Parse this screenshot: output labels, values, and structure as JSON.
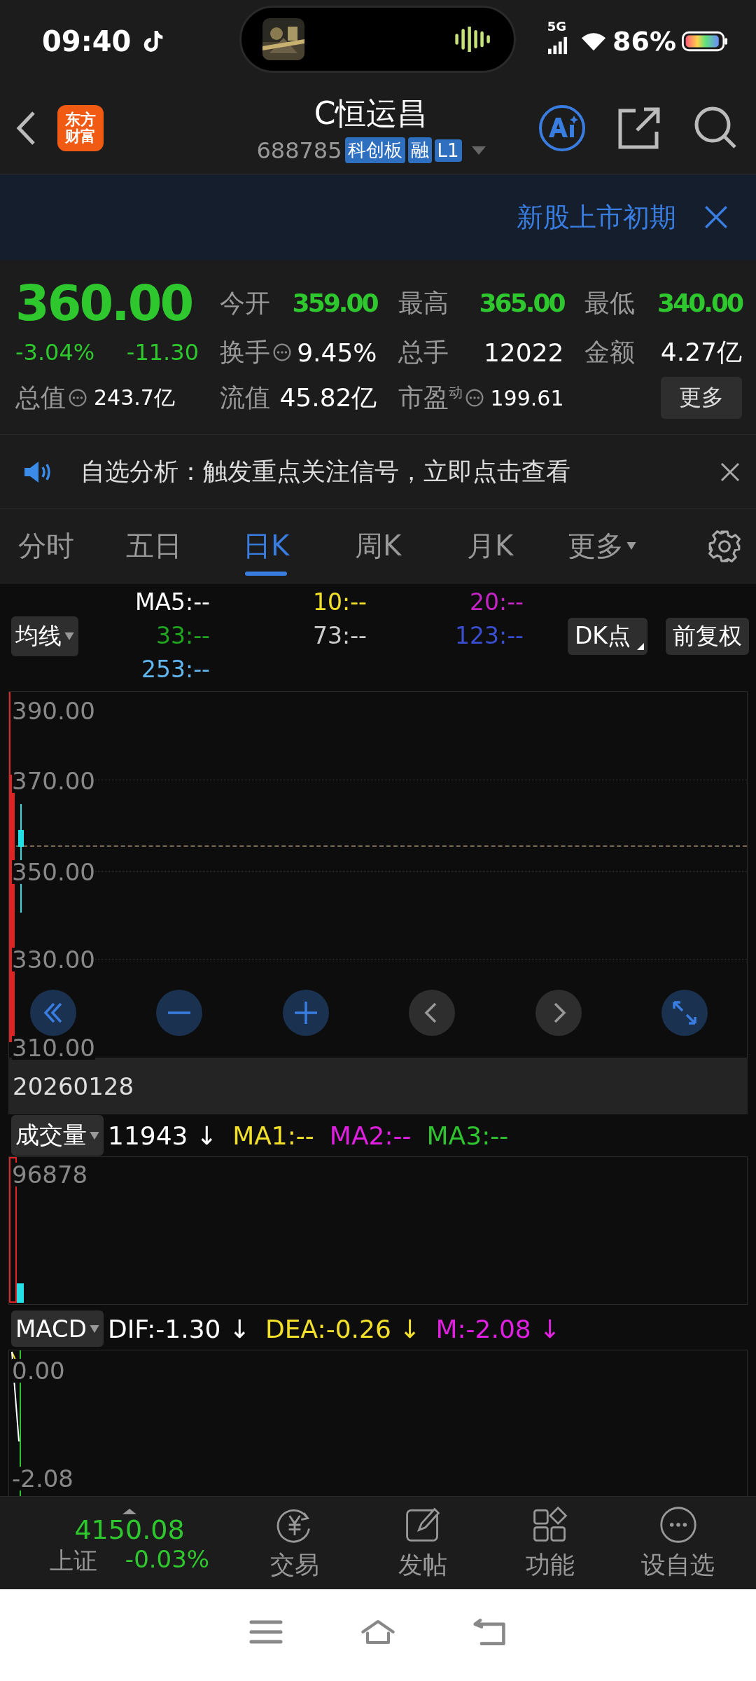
{
  "status_bar": {
    "time": "09:40",
    "network": "5G",
    "battery": "86%"
  },
  "header": {
    "logo_lines": [
      "东方",
      "财富"
    ],
    "title": "C恒运昌",
    "code": "688785",
    "tags": [
      "科创板",
      "融",
      "L1"
    ]
  },
  "banner": {
    "text": "新股上市初期"
  },
  "quote": {
    "price": "360.00",
    "change_pct": "-3.04%",
    "change": "-11.30",
    "stats": [
      {
        "label": "今开",
        "value": "359.00",
        "kind": "price",
        "info": false
      },
      {
        "label": "最高",
        "value": "365.00",
        "kind": "price",
        "info": false
      },
      {
        "label": "最低",
        "value": "340.00",
        "kind": "price",
        "info": false
      },
      {
        "label": "换手",
        "value": "9.45%",
        "kind": "plain",
        "info": true
      },
      {
        "label": "总手",
        "value": "12022",
        "kind": "plain",
        "info": false
      },
      {
        "label": "金额",
        "value": "4.27亿",
        "kind": "plain",
        "info": false
      },
      {
        "label": "总值",
        "value": "243.7亿",
        "kind": "small",
        "info": true
      },
      {
        "label": "流值",
        "value": "45.82亿",
        "kind": "plain",
        "info": false
      },
      {
        "label": "市盈$^{动}$",
        "value": "199.61",
        "kind": "small",
        "info": true
      }
    ],
    "more_button": "更多"
  },
  "notice": {
    "text": "自选分析：触发重点关注信号，立即点击查看"
  },
  "tabs": [
    {
      "label": "分时",
      "selected": false,
      "dropdown": false
    },
    {
      "label": "五日",
      "selected": false,
      "dropdown": false
    },
    {
      "label": "日K",
      "selected": true,
      "dropdown": false
    },
    {
      "label": "周K",
      "selected": false,
      "dropdown": false
    },
    {
      "label": "月K",
      "selected": false,
      "dropdown": false
    },
    {
      "label": "更多",
      "selected": false,
      "dropdown": true
    }
  ],
  "ma_bar": {
    "selector": "均线",
    "buttons": [
      "DK点",
      "前复权"
    ],
    "items": [
      {
        "text": "MA5:--",
        "color": "#ffffff"
      },
      {
        "text": "10:--",
        "color": "#f2e02a"
      },
      {
        "text": "20:--",
        "color": "#c424c4"
      },
      {
        "text": "33:--",
        "color": "#1fa51f"
      },
      {
        "text": "73:--",
        "color": "#cccccc"
      },
      {
        "text": "123:--",
        "color": "#3a4fd0"
      },
      {
        "text": "253:--",
        "color": "#62b6ee"
      }
    ]
  },
  "price_chart": {
    "axis": [
      "390.00",
      "370.00",
      "350.00",
      "330.00",
      "310.00"
    ],
    "date": "20260128"
  },
  "volume": {
    "selector": "成交量",
    "items": [
      {
        "text": "11943 ↓",
        "color": "#ffffff"
      },
      {
        "text": "MA1:--",
        "color": "#f2e02a"
      },
      {
        "text": "MA2:--",
        "color": "#e020e0"
      },
      {
        "text": "MA3:--",
        "color": "#2fc42f"
      }
    ],
    "axis": [
      "96878"
    ]
  },
  "macd": {
    "selector": "MACD",
    "items": [
      {
        "text": "DIF:-1.30 ↓",
        "color": "#ffffff"
      },
      {
        "text": "DEA:-0.26 ↓",
        "color": "#f2e02a"
      },
      {
        "text": "M:-2.08 ↓",
        "color": "#e020e0"
      }
    ],
    "axis": [
      "0.00",
      "-2.08"
    ]
  },
  "bottom_nav": {
    "index": {
      "value": "4150.08",
      "name": "上证",
      "change": "-0.03%"
    },
    "items": [
      {
        "label": "交易",
        "kind": "trade"
      },
      {
        "label": "发帖",
        "kind": "post"
      },
      {
        "label": "功能",
        "kind": "apps"
      },
      {
        "label": "设自选",
        "kind": "more"
      }
    ]
  }
}
